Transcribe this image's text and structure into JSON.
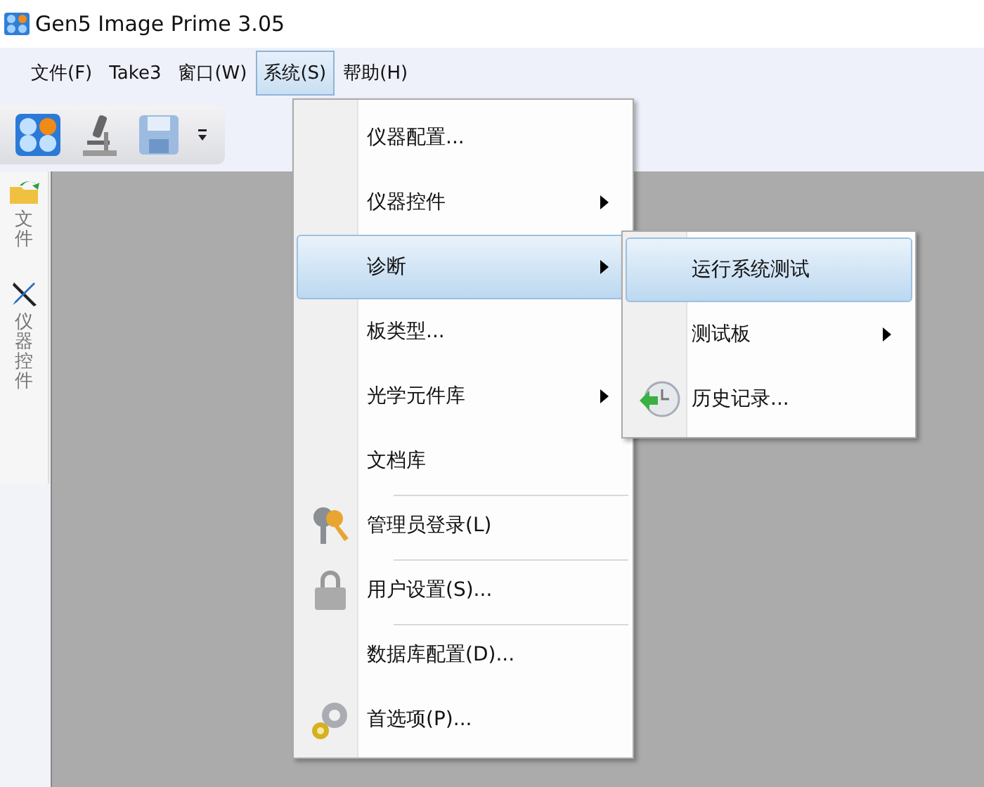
{
  "window": {
    "title": "Gen5 Image Prime 3.05"
  },
  "menubar": [
    {
      "label": "文件(F)",
      "selected": false
    },
    {
      "label": "Take3",
      "selected": false
    },
    {
      "label": "窗口(W)",
      "selected": false
    },
    {
      "label": "系统(S)",
      "selected": true
    },
    {
      "label": "帮助(H)",
      "selected": false
    }
  ],
  "dock_tabs": [
    {
      "label": "文件"
    },
    {
      "label": "仪器控件"
    }
  ],
  "system_menu": [
    {
      "label": "仪器配置...",
      "selected": false,
      "submenu": false,
      "separator_before": false
    },
    {
      "label": "仪器控件",
      "selected": false,
      "submenu": true,
      "separator_before": false
    },
    {
      "label": "诊断",
      "selected": true,
      "submenu": true,
      "separator_before": false
    },
    {
      "label": "板类型...",
      "selected": false,
      "submenu": false,
      "separator_before": false
    },
    {
      "label": "光学元件库",
      "selected": false,
      "submenu": true,
      "separator_before": false
    },
    {
      "label": "文档库",
      "selected": false,
      "submenu": false,
      "separator_before": false
    },
    {
      "label": "管理员登录(L)",
      "selected": false,
      "submenu": false,
      "separator_before": true
    },
    {
      "label": "用户设置(S)...",
      "selected": false,
      "submenu": false,
      "separator_before": true
    },
    {
      "label": "数据库配置(D)...",
      "selected": false,
      "submenu": false,
      "separator_before": true
    },
    {
      "label": "首选项(P)...",
      "selected": false,
      "submenu": false,
      "separator_before": false
    }
  ],
  "diagnostics_submenu": [
    {
      "label": "运行系统测试",
      "selected": true,
      "submenu": false
    },
    {
      "label": "测试板",
      "selected": false,
      "submenu": true
    },
    {
      "label": "历史记录...",
      "selected": false,
      "submenu": false
    }
  ]
}
